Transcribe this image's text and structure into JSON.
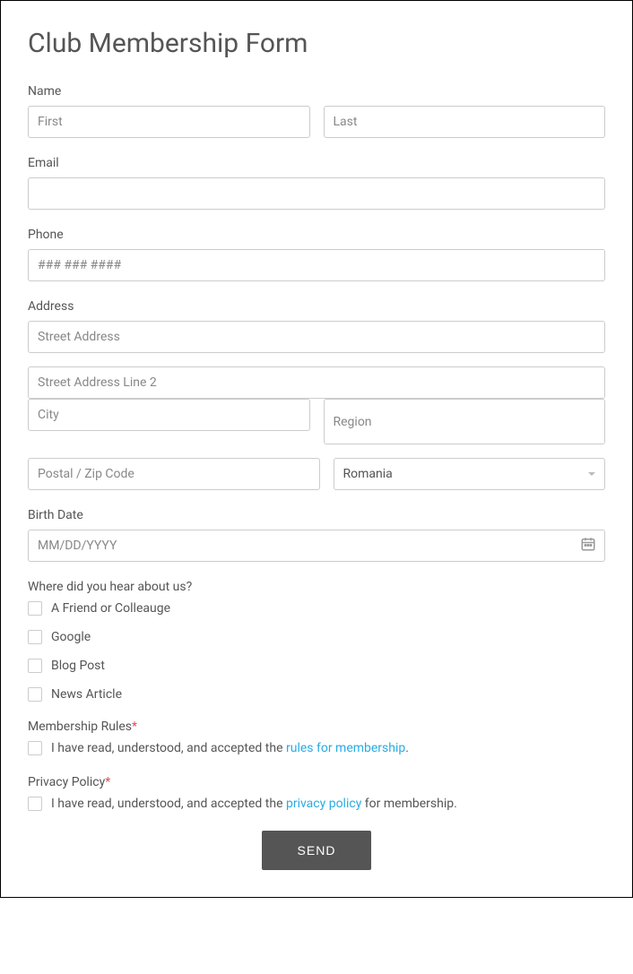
{
  "title": "Club Membership Form",
  "name": {
    "label": "Name",
    "first_placeholder": "First",
    "last_placeholder": "Last"
  },
  "email": {
    "label": "Email"
  },
  "phone": {
    "label": "Phone",
    "placeholder": "### ### ####"
  },
  "address": {
    "label": "Address",
    "street_placeholder": "Street Address",
    "street2_placeholder": "Street Address Line 2",
    "city_placeholder": "City",
    "region_placeholder": "Region",
    "postal_placeholder": "Postal / Zip Code",
    "country_value": "Romania"
  },
  "birthdate": {
    "label": "Birth Date",
    "placeholder": "MM/DD/YYYY"
  },
  "hear_about": {
    "label": "Where did you hear about us?",
    "options": [
      "A Friend or Colleauge",
      "Google",
      "Blog Post",
      "News Article"
    ]
  },
  "membership_rules": {
    "label": "Membership Rules",
    "prefix": "I have read, understood, and accepted the ",
    "link": "rules for membership",
    "suffix": "."
  },
  "privacy_policy": {
    "label": "Privacy Policy",
    "prefix": "I have read, understood, and accepted the ",
    "link": "privacy policy",
    "suffix": " for membership."
  },
  "submit_label": "SEND"
}
